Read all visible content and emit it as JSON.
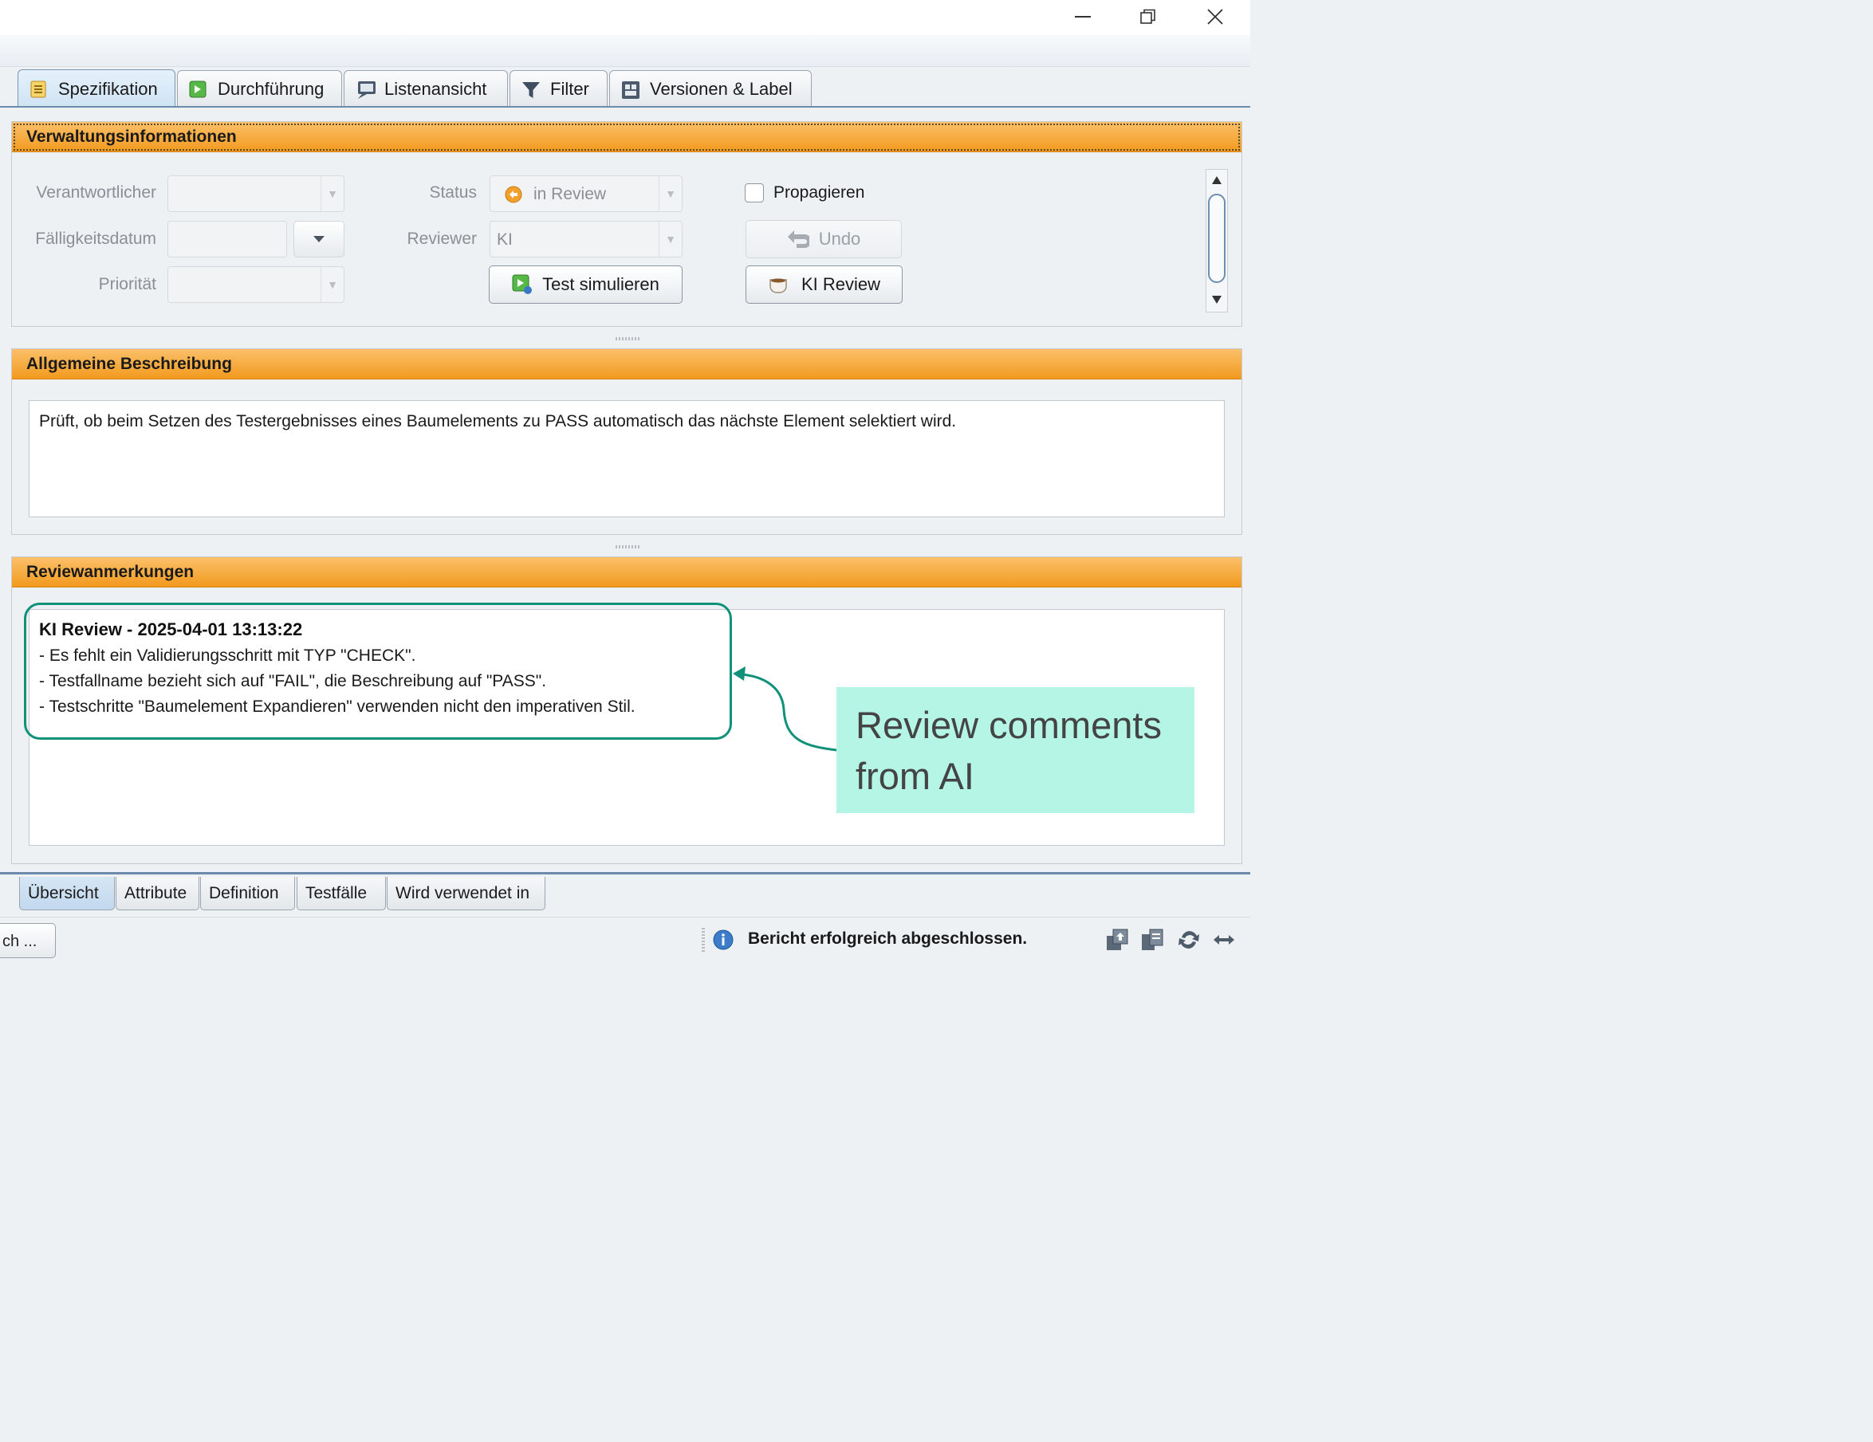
{
  "window": {
    "buttons": [
      {
        "name": "minimize-icon",
        "glyph": "—"
      },
      {
        "name": "restore-icon",
        "glyph": "❐"
      },
      {
        "name": "close-icon",
        "glyph": "✕"
      }
    ]
  },
  "top_tabs": [
    {
      "label": "Spezifikation",
      "icon": "list-icon",
      "active": true
    },
    {
      "label": "Durchführung",
      "icon": "run-icon",
      "active": false
    },
    {
      "label": "Listenansicht",
      "icon": "list-view-icon",
      "active": false
    },
    {
      "label": "Filter",
      "icon": "filter-icon",
      "active": false
    },
    {
      "label": "Versionen & Label",
      "icon": "versions-icon",
      "active": false
    }
  ],
  "admin": {
    "title": "Verwaltungsinformationen",
    "responsible_label": "Verantwortlicher",
    "responsible_value": "",
    "due_label": "Fälligkeitsdatum",
    "due_value": "",
    "priority_label": "Priorität",
    "priority_value": "",
    "status_label": "Status",
    "status_value": "in Review",
    "reviewer_label": "Reviewer",
    "reviewer_value": "KI",
    "simulate_button": "Test simulieren",
    "propagate_label": "Propagieren",
    "propagate_checked": false,
    "undo_button": "Undo",
    "ai_review_button": "KI Review"
  },
  "description": {
    "title": "Allgemeine Beschreibung",
    "text": "Prüft, ob beim Setzen des Testergebnisses eines Baumelements zu PASS automatisch das nächste Element selektiert wird."
  },
  "review": {
    "title": "Reviewanmerkungen",
    "heading": "KI Review - 2025-04-01 13:13:22",
    "lines": [
      "- Es fehlt ein Validierungsschritt mit TYP \"CHECK\".",
      "- Testfallname bezieht sich auf \"FAIL\", die Beschreibung auf \"PASS\".",
      "- Testschritte \"Baumelement Expandieren\" verwenden nicht den imperativen Stil."
    ]
  },
  "annotation": {
    "text": "Review comments from AI",
    "color": "#12917a",
    "fill": "#b4f5e6"
  },
  "bottom_tabs": [
    {
      "label": "Übersicht",
      "active": true
    },
    {
      "label": "Attribute",
      "active": false
    },
    {
      "label": "Definition",
      "active": false
    },
    {
      "label": "Testfälle",
      "active": false
    },
    {
      "label": "Wird verwendet in",
      "active": false
    }
  ],
  "status": {
    "search_button": "ch ...",
    "message": "Bericht erfolgreich abgeschlossen."
  },
  "colors": {
    "panel_header": "#f29a1e",
    "tab_accent": "#6b8bad"
  }
}
